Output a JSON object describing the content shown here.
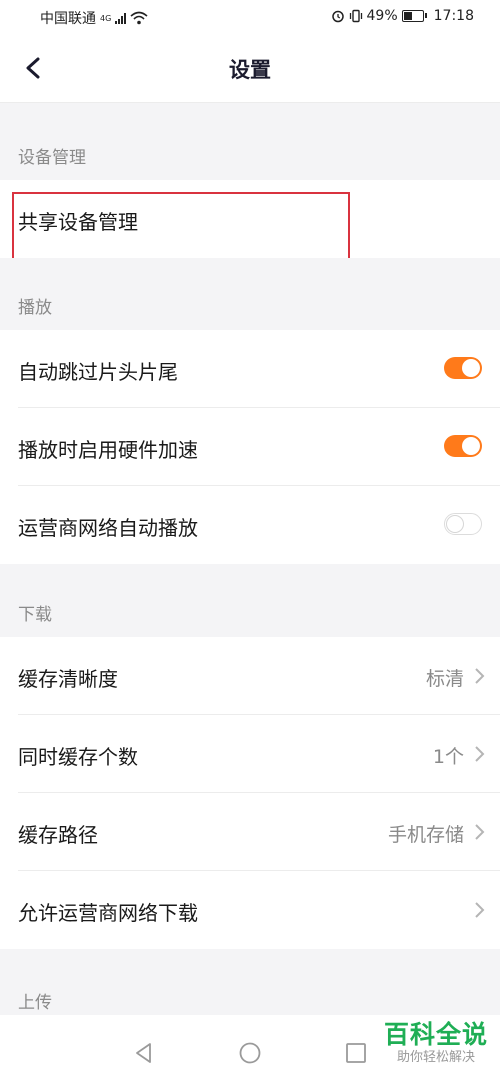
{
  "status_bar": {
    "carrier": "中国联通",
    "network": "4G",
    "battery": "49%",
    "time": "17:18"
  },
  "header": {
    "title": "设置"
  },
  "sections": {
    "device": {
      "title": "设备管理",
      "shared_devices": {
        "label": "共享设备管理"
      }
    },
    "playback": {
      "title": "播放",
      "skip_intro": {
        "label": "自动跳过片头片尾",
        "on": true
      },
      "hw_accel": {
        "label": "播放时启用硬件加速",
        "on": true
      },
      "cellular_autoplay": {
        "label": "运营商网络自动播放",
        "on": false
      }
    },
    "download": {
      "title": "下载",
      "cache_quality": {
        "label": "缓存清晰度",
        "value": "标清"
      },
      "concurrent": {
        "label": "同时缓存个数",
        "value": "1个"
      },
      "cache_path": {
        "label": "缓存路径",
        "value": "手机存储"
      },
      "cellular_download": {
        "label": "允许运营商网络下载"
      }
    },
    "upload": {
      "title": "上传"
    }
  },
  "watermark": {
    "main": "百科全说",
    "sub": "助你轻松解决"
  },
  "colors": {
    "toggle_on": "#ff7a1a",
    "highlight": "#d9333f",
    "watermark": "#1fae55"
  }
}
